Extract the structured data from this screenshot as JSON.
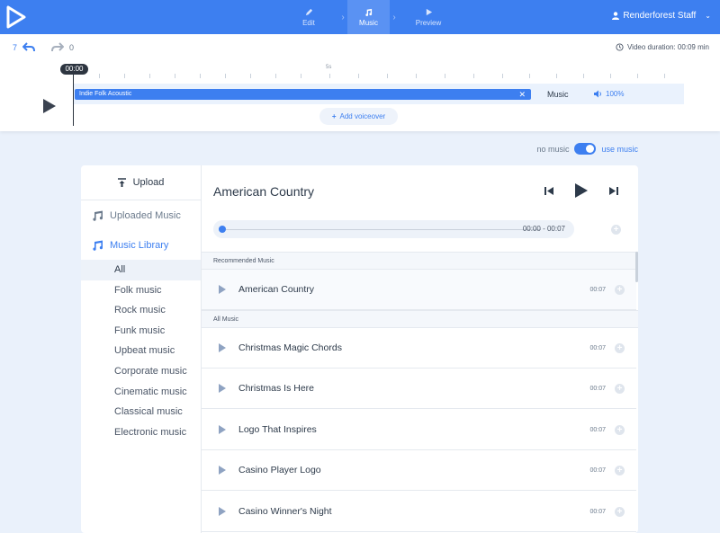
{
  "header": {
    "nav": [
      {
        "label": "Edit",
        "icon": "pencil-icon",
        "active": false
      },
      {
        "label": "Music",
        "icon": "music-note-icon",
        "active": true
      },
      {
        "label": "Preview",
        "icon": "play-icon",
        "active": false
      }
    ],
    "user_name": "Renderforest Staff"
  },
  "timeline": {
    "undo_count": "7",
    "redo_count": "0",
    "video_duration": "Video duration: 00:09 min",
    "current_time": "00:00",
    "ruler_label": "5s",
    "track_name": "Indie Folk Acoustic",
    "track_label": "Music",
    "volume": "100%",
    "add_voiceover": "Add voiceover"
  },
  "music_toggle": {
    "off_label": "no music",
    "on_label": "use music",
    "enabled": true
  },
  "sidebar": {
    "upload": "Upload",
    "uploaded_music": "Uploaded Music",
    "music_library": "Music Library",
    "categories": [
      "All",
      "Folk music",
      "Rock music",
      "Funk music",
      "Upbeat music",
      "Corporate music",
      "Cinematic music",
      "Classical music",
      "Electronic music"
    ],
    "selected": "All"
  },
  "player": {
    "title": "American Country",
    "time_range": "00:00 - 00:07"
  },
  "recommended": {
    "heading": "Recommended Music",
    "items": [
      {
        "name": "American Country",
        "duration": "00:07"
      }
    ]
  },
  "all_music": {
    "heading": "All Music",
    "items": [
      {
        "name": "Christmas Magic Chords",
        "duration": "00:07"
      },
      {
        "name": "Christmas Is Here",
        "duration": "00:07"
      },
      {
        "name": "Logo That Inspires",
        "duration": "00:07"
      },
      {
        "name": "Casino Player Logo",
        "duration": "00:07"
      },
      {
        "name": "Casino Winner's Night",
        "duration": "00:07"
      }
    ]
  },
  "colors": {
    "accent": "#3d7ff0",
    "header_bg": "#3d7ff0",
    "page_bg": "#eaf1fb"
  }
}
